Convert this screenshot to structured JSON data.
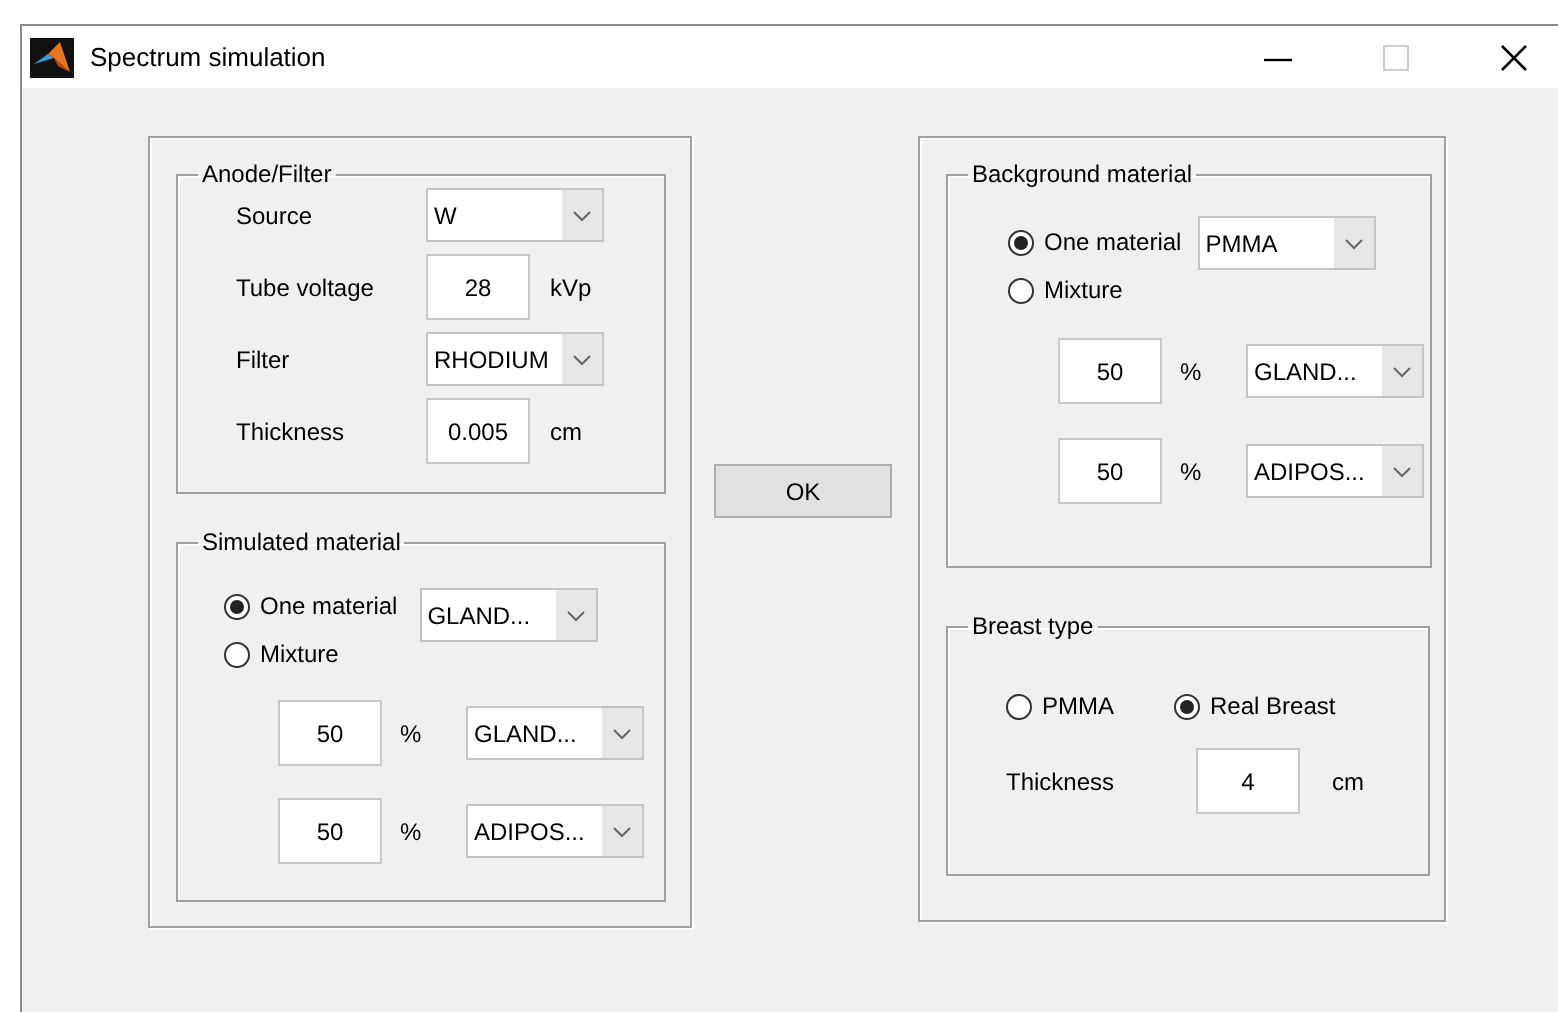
{
  "window": {
    "title": "Spectrum simulation"
  },
  "anode_filter": {
    "title": "Anode/Filter",
    "source": {
      "label": "Source",
      "value": "W"
    },
    "tube_voltage": {
      "label": "Tube voltage",
      "value": "28",
      "unit": "kVp"
    },
    "filter": {
      "label": "Filter",
      "value": "RHODIUM"
    },
    "thickness": {
      "label": "Thickness",
      "value": "0.005",
      "unit": "cm"
    }
  },
  "simulated_material": {
    "title": "Simulated material",
    "options": [
      {
        "label": "One material",
        "selected": true
      },
      {
        "label": "Mixture",
        "selected": false
      }
    ],
    "one_material": "GLAND...",
    "mixture": [
      {
        "percent": "50",
        "unit": "%",
        "material": "GLAND..."
      },
      {
        "percent": "50",
        "unit": "%",
        "material": "ADIPOS..."
      }
    ]
  },
  "ok_button": "OK",
  "background_material": {
    "title": "Background material",
    "options": [
      {
        "label": "One material",
        "selected": true
      },
      {
        "label": "Mixture",
        "selected": false
      }
    ],
    "one_material": "PMMA",
    "mixture": [
      {
        "percent": "50",
        "unit": "%",
        "material": "GLAND..."
      },
      {
        "percent": "50",
        "unit": "%",
        "material": "ADIPOS..."
      }
    ]
  },
  "breast_type": {
    "title": "Breast type",
    "options": [
      {
        "label": "PMMA",
        "selected": false
      },
      {
        "label": "Real Breast",
        "selected": true
      }
    ],
    "thickness": {
      "label": "Thickness",
      "value": "4",
      "unit": "cm"
    }
  }
}
